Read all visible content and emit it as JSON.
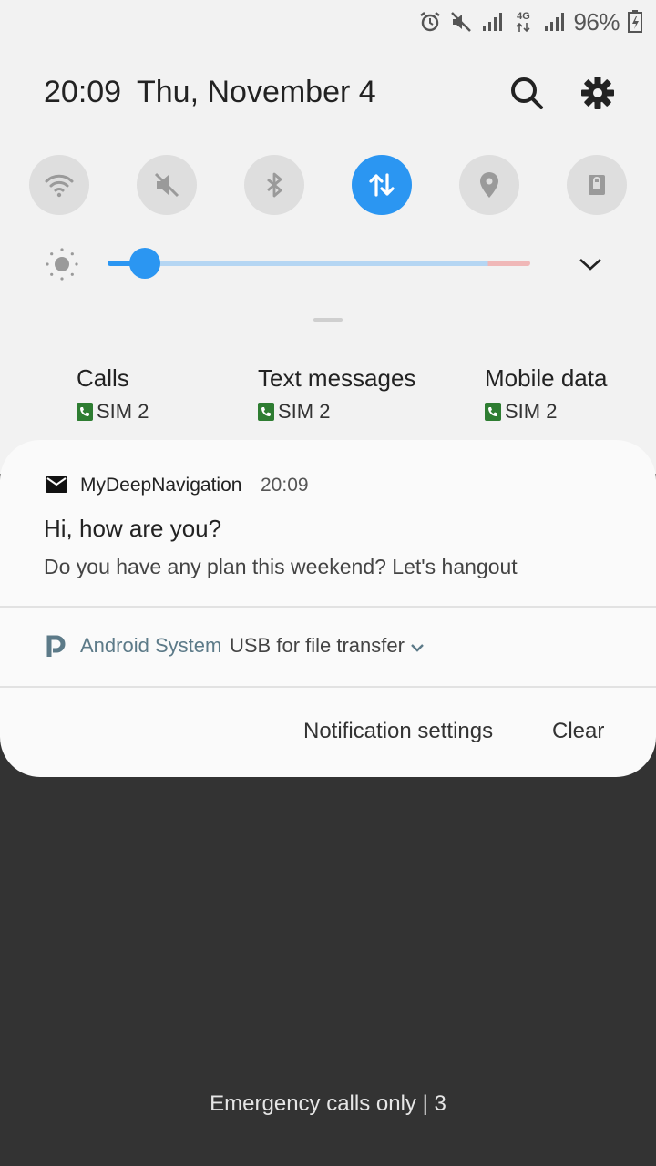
{
  "status_bar": {
    "network_label": "4G",
    "battery_percent": "96%"
  },
  "header": {
    "time": "20:09",
    "date": "Thu, November 4"
  },
  "quick_toggles": [
    {
      "name": "wifi",
      "icon": "wifi-icon",
      "active": false
    },
    {
      "name": "sound",
      "icon": "mute-icon",
      "active": false
    },
    {
      "name": "bluetooth",
      "icon": "bluetooth-icon",
      "active": false
    },
    {
      "name": "mobile-data",
      "icon": "data-arrows-icon",
      "active": true
    },
    {
      "name": "location",
      "icon": "location-pin-icon",
      "active": false
    },
    {
      "name": "screen-lock",
      "icon": "lock-icon",
      "active": false
    }
  ],
  "brightness": {
    "level": 0.09
  },
  "sim_info": [
    {
      "title": "Calls",
      "sim": "SIM 2"
    },
    {
      "title": "Text messages",
      "sim": "SIM 2"
    },
    {
      "title": "Mobile data",
      "sim": "SIM 2"
    }
  ],
  "notifications": {
    "message": {
      "app_name": "MyDeepNavigation",
      "time": "20:09",
      "title": "Hi, how are you?",
      "body": "Do you have any plan this weekend? Let's hangout"
    },
    "system": {
      "app_name": "Android System",
      "text": "USB for file transfer"
    },
    "actions": {
      "settings_label": "Notification settings",
      "clear_label": "Clear"
    }
  },
  "footer": {
    "emergency_text": "Emergency calls only | 3"
  },
  "colors": {
    "accent": "#2b96f2",
    "panel_bg": "#f2f2f2",
    "lock_bg": "#333333"
  }
}
